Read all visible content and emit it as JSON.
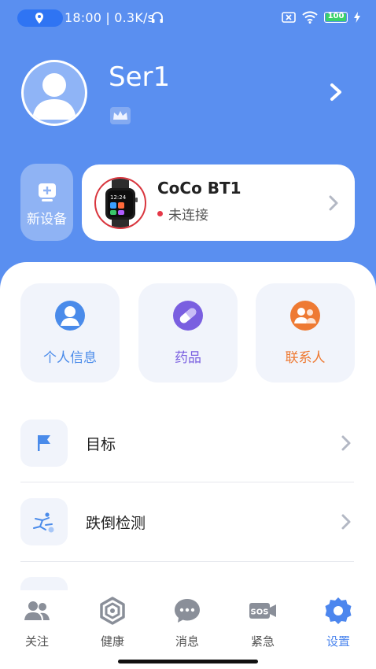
{
  "status_bar": {
    "time_speed": "18:00 | 0.3K/s",
    "battery": "100",
    "colors": {
      "location_pill": "#2f74f3",
      "battery_fill": "#3ad16a"
    }
  },
  "profile": {
    "username": "Ser1"
  },
  "new_device": {
    "label": "新设备"
  },
  "device": {
    "name": "CoCo BT1",
    "status": "未连接",
    "watch_time": "12:24"
  },
  "quick_actions": [
    {
      "label": "个人信息",
      "icon": "person-icon",
      "color": "#4a8bea"
    },
    {
      "label": "药品",
      "icon": "pill-icon",
      "color": "#7a5fe0"
    },
    {
      "label": "联系人",
      "icon": "contacts-icon",
      "color": "#ee7a33"
    }
  ],
  "menu": [
    {
      "label": "目标",
      "icon": "flag-icon"
    },
    {
      "label": "跌倒检测",
      "icon": "fall-detection-icon"
    }
  ],
  "tabs": [
    {
      "label": "关注",
      "icon": "people-icon"
    },
    {
      "label": "健康",
      "icon": "health-icon"
    },
    {
      "label": "消息",
      "icon": "message-icon"
    },
    {
      "label": "紧急",
      "icon": "sos-icon",
      "icon_text": "SOS"
    },
    {
      "label": "设置",
      "icon": "settings-icon",
      "active": true
    }
  ],
  "colors": {
    "header_bg": "#5a8ff0",
    "accent": "#4c86ee",
    "disconnected": "#e53848"
  }
}
